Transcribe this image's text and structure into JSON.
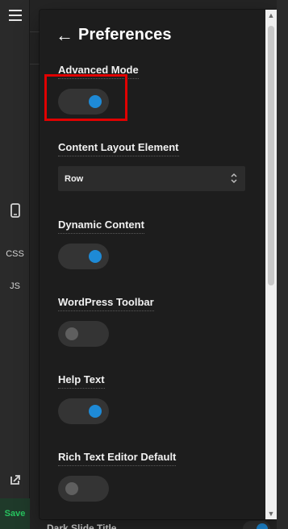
{
  "sidebar": {
    "menu_icon": "hamburger-icon",
    "device_icon": "mobile-device-icon",
    "css_label": "CSS",
    "js_label": "JS",
    "external_icon": "external-link-icon",
    "save_label": "Save"
  },
  "preferences": {
    "title": "Preferences",
    "back_icon": "arrow-left-icon",
    "settings": [
      {
        "label": "Advanced Mode",
        "type": "toggle",
        "enabled": true
      },
      {
        "label": "Content Layout Element",
        "type": "select",
        "value": "Row"
      },
      {
        "label": "Dynamic Content",
        "type": "toggle",
        "enabled": true
      },
      {
        "label": "WordPress Toolbar",
        "type": "toggle",
        "enabled": false
      },
      {
        "label": "Help Text",
        "type": "toggle",
        "enabled": true
      },
      {
        "label": "Rich Text Editor Default",
        "type": "toggle",
        "enabled": false
      }
    ],
    "background_partial_label": "Dark Slide Title"
  },
  "colors": {
    "panel_background": "#1d1d1d",
    "accent": "#1e8ad6",
    "toggle_off_knob": "#5f5f5f",
    "highlight": "#e00000",
    "save_text": "#27c45f"
  }
}
